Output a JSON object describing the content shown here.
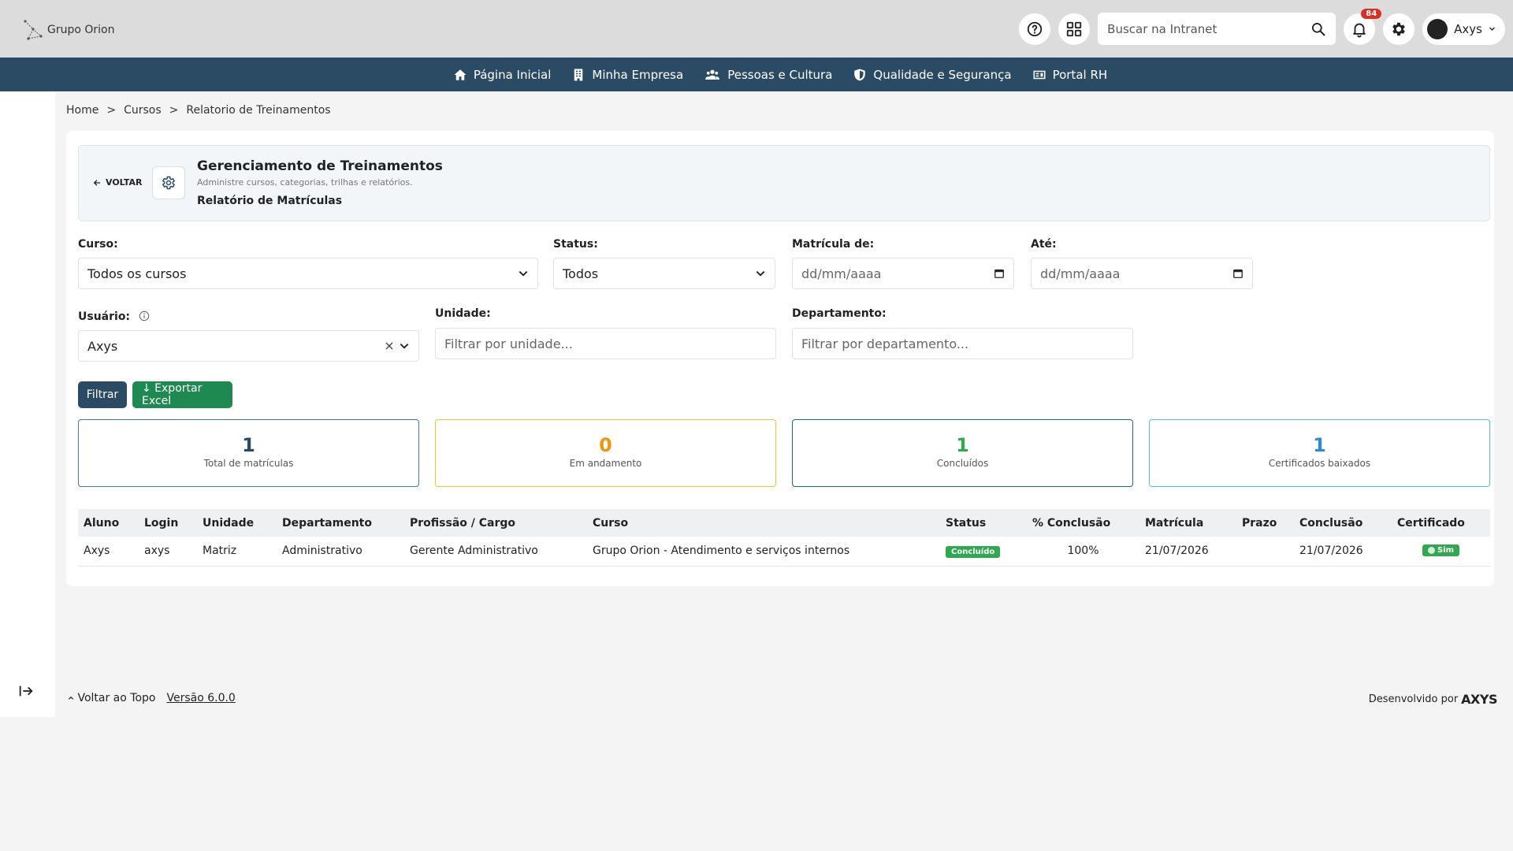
{
  "header": {
    "logo_text": "Grupo Orion",
    "search_placeholder": "Buscar na Intranet",
    "notifications_count": "84",
    "user_name": "Axys"
  },
  "nav": {
    "items": [
      {
        "label": "Página Inicial",
        "icon": "home-icon"
      },
      {
        "label": "Minha Empresa",
        "icon": "building-icon"
      },
      {
        "label": "Pessoas e Cultura",
        "icon": "people-icon"
      },
      {
        "label": "Qualidade e Segurança",
        "icon": "shield-icon"
      },
      {
        "label": "Portal RH",
        "icon": "id-card-icon"
      }
    ]
  },
  "breadcrumb": [
    "Home",
    ">",
    "Cursos",
    ">",
    "Relatorio de Treinamentos"
  ],
  "page_header": {
    "back_label": "VOLTAR",
    "title": "Gerenciamento de Treinamentos",
    "subtitle": "Administre cursos, categorias, trilhas e relatórios.",
    "section": "Relatório de Matrículas"
  },
  "filters": {
    "curso_label": "Curso:",
    "curso_value": "Todos os cursos",
    "status_label": "Status:",
    "status_value": "Todos",
    "matricula_de_label": "Matrícula de:",
    "matricula_de_placeholder": "dd/mm/aaaa",
    "ate_label": "Até:",
    "ate_placeholder": "dd/mm/aaaa",
    "usuario_label": "Usuário:",
    "usuario_value": "Axys",
    "unidade_label": "Unidade:",
    "unidade_placeholder": "Filtrar por unidade...",
    "departamento_label": "Departamento:",
    "departamento_placeholder": "Filtrar por departamento...",
    "filter_button": "Filtrar",
    "export_button": "↓ Exportar Excel"
  },
  "stats": [
    {
      "value": "1",
      "caption": "Total de matrículas",
      "color": "#2b4a64",
      "border": "#3a78c2"
    },
    {
      "value": "0",
      "caption": "Em andamento",
      "color": "#f0960e",
      "border": "#f2c230"
    },
    {
      "value": "1",
      "caption": "Concluídos",
      "color": "#2fa84f",
      "border": "#1e6b6b"
    },
    {
      "value": "1",
      "caption": "Certificados baixados",
      "color": "#2b8ad9",
      "border": "#4fc3d9"
    }
  ],
  "table": {
    "headers": [
      "Aluno",
      "Login",
      "Unidade",
      "Departamento",
      "Profissão / Cargo",
      "Curso",
      "Status",
      "% Conclusão",
      "Matrícula",
      "Prazo",
      "Conclusão",
      "Certificado"
    ],
    "rows": [
      {
        "aluno": "Axys",
        "login": "axys",
        "unidade": "Matriz",
        "departamento": "Administrativo",
        "cargo": "Gerente Administrativo",
        "curso": "Grupo Orion - Atendimento e serviços internos",
        "status": "Concluído",
        "conclusao_pct": "100%",
        "matricula": "21/07/2026",
        "prazo": "",
        "conclusao": "21/07/2026",
        "certificado": "Sim"
      }
    ]
  },
  "footer": {
    "back_to_top": "Voltar ao Topo",
    "version": "Versão 6.0.0",
    "developed_by": "Desenvolvido por",
    "brand": "AXYS"
  }
}
